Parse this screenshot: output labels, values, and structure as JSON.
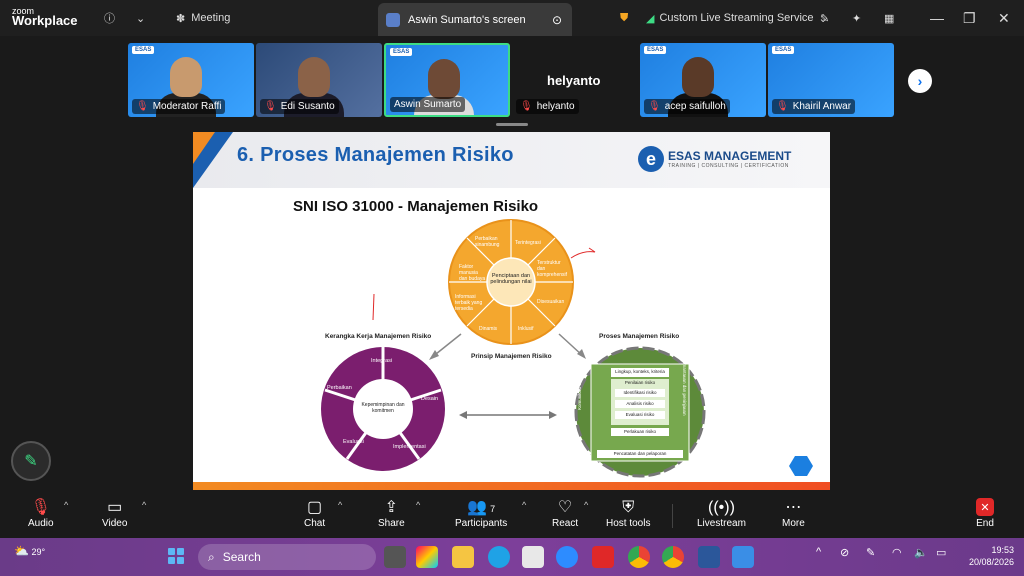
{
  "app": {
    "logo_top": "zoom",
    "logo_bottom": "Workplace",
    "meeting_label": "Meeting",
    "tab_label": "Aswin Sumarto's screen",
    "livestream_label": "Custom Live Streaming Service"
  },
  "participants": [
    {
      "name": "Moderator Raffi",
      "muted": true
    },
    {
      "name": "Edi Susanto",
      "muted": true
    },
    {
      "name": "Aswin Sumarto",
      "muted": false
    },
    {
      "name": "helyanto",
      "muted": true
    },
    {
      "name": "acep saifulloh",
      "muted": true
    },
    {
      "name": "Khairil Anwar",
      "muted": true
    }
  ],
  "participant_big_name": "helyanto",
  "slide": {
    "title": "6. Proses Manajemen Risiko",
    "brand_name": "ESAS MANAGEMENT",
    "brand_tag": "TRAINING | CONSULTING | CERTIFICATION",
    "subtitle": "SNI ISO 31000  - Manajemen Risiko",
    "principles_center": "Penciptaan dan pelindungan nilai",
    "principles": [
      "Terintegrasi",
      "Terstruktur dan komprehensif",
      "Disesuaikan",
      "Inklusif",
      "Dinamis",
      "Informasi terbaik yang tersedia",
      "Faktor manusia dan budaya",
      "Perbaikan sinambung"
    ],
    "principles_label": "Prinsip Manajemen Risiko",
    "framework_label": "Kerangka Kerja Manajemen Risiko",
    "framework_center": "Kepemimpinan dan komitmen",
    "framework_items": [
      "Integrasi",
      "Desain",
      "Implementasi",
      "Evaluasi",
      "Perbaikan"
    ],
    "process_label": "Proses Manajemen Risiko",
    "process_items": [
      "Lingkup, konteks, kriteria",
      "Penilaian risiko",
      "Identifikasi risiko",
      "Analisis risiko",
      "Evaluasi risiko",
      "Perlakuan risiko",
      "Pencatatan dan pelaporan"
    ],
    "process_left": "Komunikasi dan konsultasi",
    "process_right": "Pemantauan dan peninjauan"
  },
  "toolbar": {
    "audio": "Audio",
    "video": "Video",
    "chat": "Chat",
    "share": "Share",
    "participants": "Participants",
    "participants_count": "7",
    "react": "React",
    "host_tools": "Host tools",
    "livestream": "Livestream",
    "more": "More",
    "end": "End"
  },
  "taskbar": {
    "temperature": "29°",
    "search_placeholder": "Search",
    "time": "19:53",
    "date": "20/08/2026"
  }
}
